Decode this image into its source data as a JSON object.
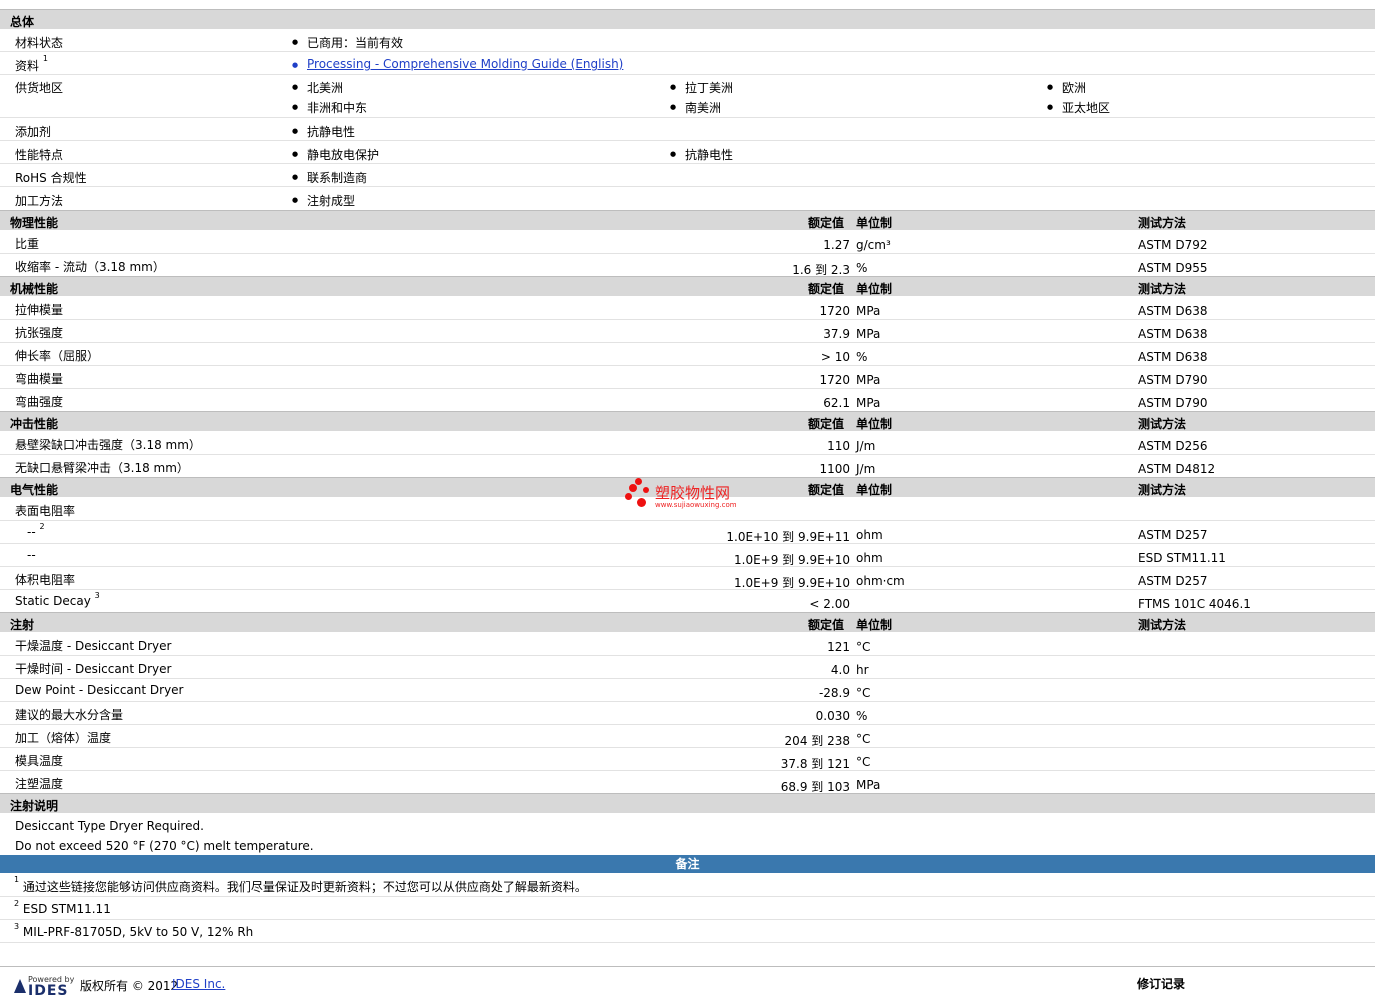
{
  "general": {
    "title": "总体",
    "rows": [
      {
        "label": "材料状态",
        "values": [
          "已商用：当前有效"
        ]
      },
      {
        "label": "资料",
        "sup": "1",
        "values": [
          "Processing - Comprehensive Molding Guide (English)"
        ],
        "link": true
      },
      {
        "label": "供货地区",
        "values": [
          "北美洲",
          "拉丁美洲",
          "欧洲",
          "非洲和中东",
          "南美洲",
          "亚太地区"
        ]
      },
      {
        "label": "添加剂",
        "values": [
          "抗静电性"
        ]
      },
      {
        "label": "性能特点",
        "values": [
          "静电放电保护",
          "抗静电性"
        ]
      },
      {
        "label": "RoHS 合规性",
        "values": [
          "联系制造商"
        ]
      },
      {
        "label": "加工方法",
        "values": [
          "注射成型"
        ]
      }
    ]
  },
  "col_headers": {
    "rated": "额定值",
    "unit": "单位制",
    "method": "测试方法"
  },
  "sections": [
    {
      "title": "物理性能",
      "rows": [
        {
          "label": "比重",
          "value": "1.27",
          "unit": "g/cm³",
          "method": "ASTM D792"
        },
        {
          "label": "收缩率  - 流动（3.18 mm）",
          "value": "1.6 到  2.3",
          "unit": "%",
          "method": "ASTM D955"
        }
      ]
    },
    {
      "title": "机械性能",
      "rows": [
        {
          "label": "拉伸模量",
          "value": "1720",
          "unit": "MPa",
          "method": "ASTM D638"
        },
        {
          "label": "抗张强度",
          "value": "37.9",
          "unit": "MPa",
          "method": "ASTM D638"
        },
        {
          "label": "伸长率（屈服）",
          "value": "> 10",
          "unit": "%",
          "method": "ASTM D638"
        },
        {
          "label": "弯曲模量",
          "value": "1720",
          "unit": "MPa",
          "method": "ASTM D790"
        },
        {
          "label": "弯曲强度",
          "value": "62.1",
          "unit": "MPa",
          "method": "ASTM D790"
        }
      ]
    },
    {
      "title": "冲击性能",
      "rows": [
        {
          "label": "悬壁梁缺口冲击强度（3.18 mm）",
          "value": "110",
          "unit": "J/m",
          "method": "ASTM D256"
        },
        {
          "label": "无缺口悬臂梁冲击（3.18 mm）",
          "value": "1100",
          "unit": "J/m",
          "method": "ASTM D4812"
        }
      ]
    },
    {
      "title": "电气性能",
      "rows": [
        {
          "label": "表面电阻率",
          "value": "",
          "unit": "",
          "method": ""
        },
        {
          "label": "--",
          "sup": "2",
          "indent": true,
          "value": "1.0E+10 到  9.9E+11",
          "unit": "ohm",
          "method": "ASTM D257"
        },
        {
          "label": "--",
          "indent": true,
          "value": "1.0E+9 到  9.9E+10",
          "unit": "ohm",
          "method": "ESD STM11.11"
        },
        {
          "label": "体积电阻率",
          "value": "1.0E+9 到  9.9E+10",
          "unit": "ohm·cm",
          "method": "ASTM D257"
        },
        {
          "label": "Static Decay",
          "sup": "3",
          "value": "< 2.00",
          "unit": "",
          "method": "FTMS 101C 4046.1"
        }
      ]
    },
    {
      "title": "注射",
      "rows": [
        {
          "label": "干燥温度  - Desiccant Dryer",
          "value": "121",
          "unit": "°C",
          "method": ""
        },
        {
          "label": "干燥时间  - Desiccant Dryer",
          "value": "4.0",
          "unit": "hr",
          "method": ""
        },
        {
          "label": "Dew Point - Desiccant Dryer",
          "value": "-28.9",
          "unit": "°C",
          "method": ""
        },
        {
          "label": "建议的最大水分含量",
          "value": "0.030",
          "unit": "%",
          "method": ""
        },
        {
          "label": "加工（熔体）温度",
          "value": "204 到  238",
          "unit": "°C",
          "method": ""
        },
        {
          "label": "模具温度",
          "value": "37.8 到  121",
          "unit": "°C",
          "method": ""
        },
        {
          "label": "注塑温度",
          "value": "68.9 到  103",
          "unit": "MPa",
          "method": ""
        }
      ]
    }
  ],
  "notes_section": {
    "title": "注射说明",
    "lines": [
      "Desiccant Type Dryer Required.",
      "Do not exceed 520 °F (270 °C) melt temperature."
    ]
  },
  "remarks": {
    "title": "备注",
    "items": [
      {
        "n": "1",
        "text": "通过这些链接您能够访问供应商资料。我们尽量保证及时更新资料；不过您可以从供应商处了解最新资料。"
      },
      {
        "n": "2",
        "text": "ESD STM11.11"
      },
      {
        "n": "3",
        "text": "MIL-PRF-81705D, 5kV to 50 V, 12% Rh"
      }
    ]
  },
  "footer": {
    "powered_by": "Powered by",
    "logo": "IDES",
    "copyright": "版权所有  © 2012",
    "company_link": "IDES Inc.",
    "revision": "修订记录"
  },
  "watermark": {
    "cn": "塑胶物性网",
    "url": "www.sujiaowuxing.com"
  }
}
